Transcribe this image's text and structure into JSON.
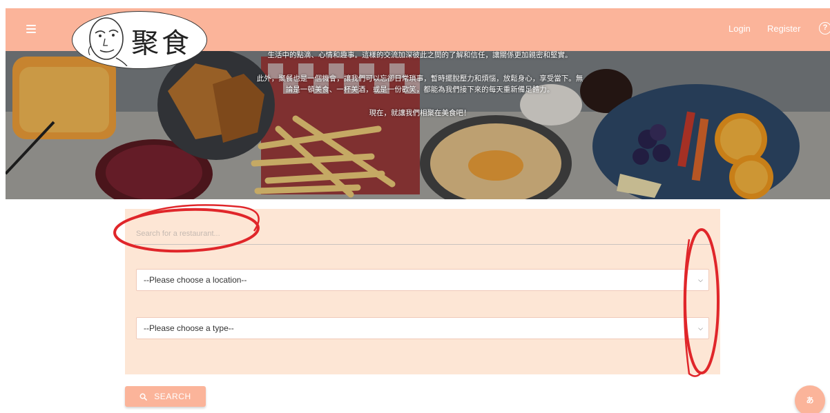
{
  "header": {
    "logo_text": "聚食",
    "nav": {
      "login": "Login",
      "register": "Register"
    },
    "help_icon": "question-circle-icon",
    "menu_icon": "hamburger-menu-icon"
  },
  "hero": {
    "paragraphs": [
      "生活中的點滴、心情和趣事。這樣的交流加深彼此之間的了解和信任，讓關係更加親密和堅實。",
      "此外，聚餐也是一個機會，讓我們可以忘卻日常瑣事，暫時擺脫壓力和煩惱，放鬆身心，享受當下。無論是一頓美食、一杯美酒，或是一份歡笑，都能為我們接下來的每天重新備足體力。",
      "現在，就讓我們相聚在美食吧！"
    ]
  },
  "search": {
    "placeholder": "Search for a restaurant...",
    "location_select": "--Please choose a location--",
    "type_select": "--Please choose a type--",
    "button_label": "SEARCH",
    "button_icon": "search-icon"
  },
  "fab": {
    "label": "あ",
    "icon": "translate-icon"
  },
  "colors": {
    "primary": "#fbb49a",
    "panel": "#fde6d5",
    "annotation": "#e0262a"
  }
}
